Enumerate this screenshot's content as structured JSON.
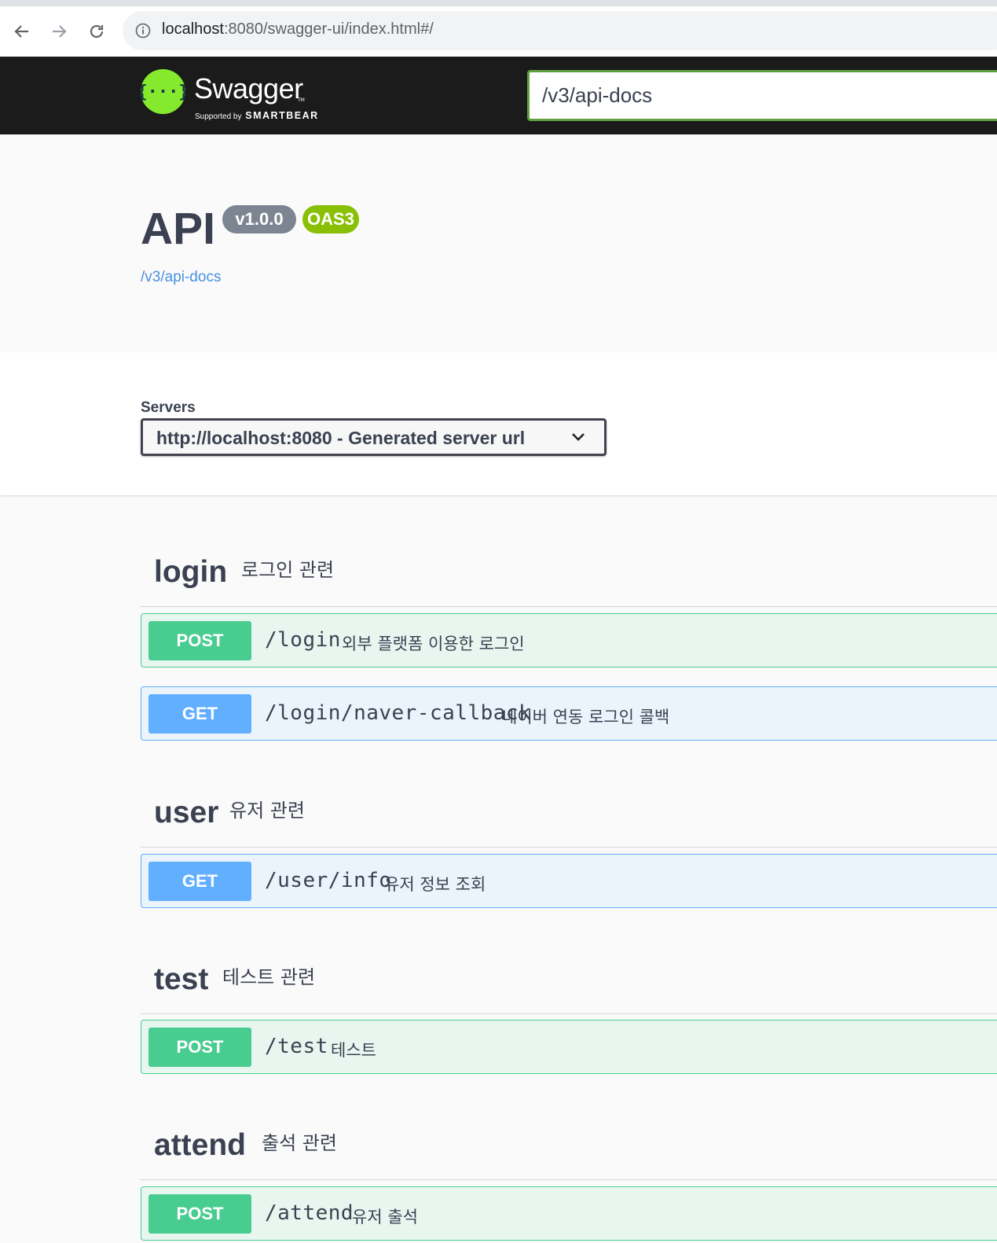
{
  "browser": {
    "url_host": "localhost",
    "url_rest": ":8080/swagger-ui/index.html#/"
  },
  "topbar": {
    "logo_text": "Swagger",
    "logo_supported": "Supported by",
    "logo_brand": "SMARTBEAR",
    "spec_url": "/v3/api-docs"
  },
  "info": {
    "title": "API",
    "version": "v1.0.0",
    "oas": "OAS3",
    "spec_link": "/v3/api-docs"
  },
  "servers": {
    "label": "Servers",
    "selected": "http://localhost:8080 - Generated server url"
  },
  "tags": [
    {
      "name": "login",
      "description": "로그인 관련",
      "operations": [
        {
          "method": "POST",
          "path": "/login",
          "summary": "외부 플랫폼 이용한 로그인"
        },
        {
          "method": "GET",
          "path": "/login/naver-callback",
          "summary": "네이버 연동 로그인 콜백"
        }
      ]
    },
    {
      "name": "user",
      "description": "유저 관련",
      "operations": [
        {
          "method": "GET",
          "path": "/user/info",
          "summary": "유저 정보 조회"
        }
      ]
    },
    {
      "name": "test",
      "description": "테스트 관련",
      "operations": [
        {
          "method": "POST",
          "path": "/test",
          "summary": "테스트"
        }
      ]
    },
    {
      "name": "attend",
      "description": "출석 관련",
      "operations": [
        {
          "method": "POST",
          "path": "/attend",
          "summary": "유저 출석"
        }
      ]
    }
  ],
  "icons": {
    "back": "back-arrow-icon",
    "forward": "forward-arrow-icon",
    "reload": "reload-icon",
    "info": "info-icon",
    "chevron": "chevron-down-icon",
    "logo": "swagger-logo-icon"
  },
  "colors": {
    "topbar": "#1b1b1b",
    "logo_green": "#85ea2d",
    "post": "#49cc90",
    "get": "#61affe",
    "version_badge": "#7d8492",
    "oas_badge": "#89bf04",
    "link": "#4990e2"
  }
}
